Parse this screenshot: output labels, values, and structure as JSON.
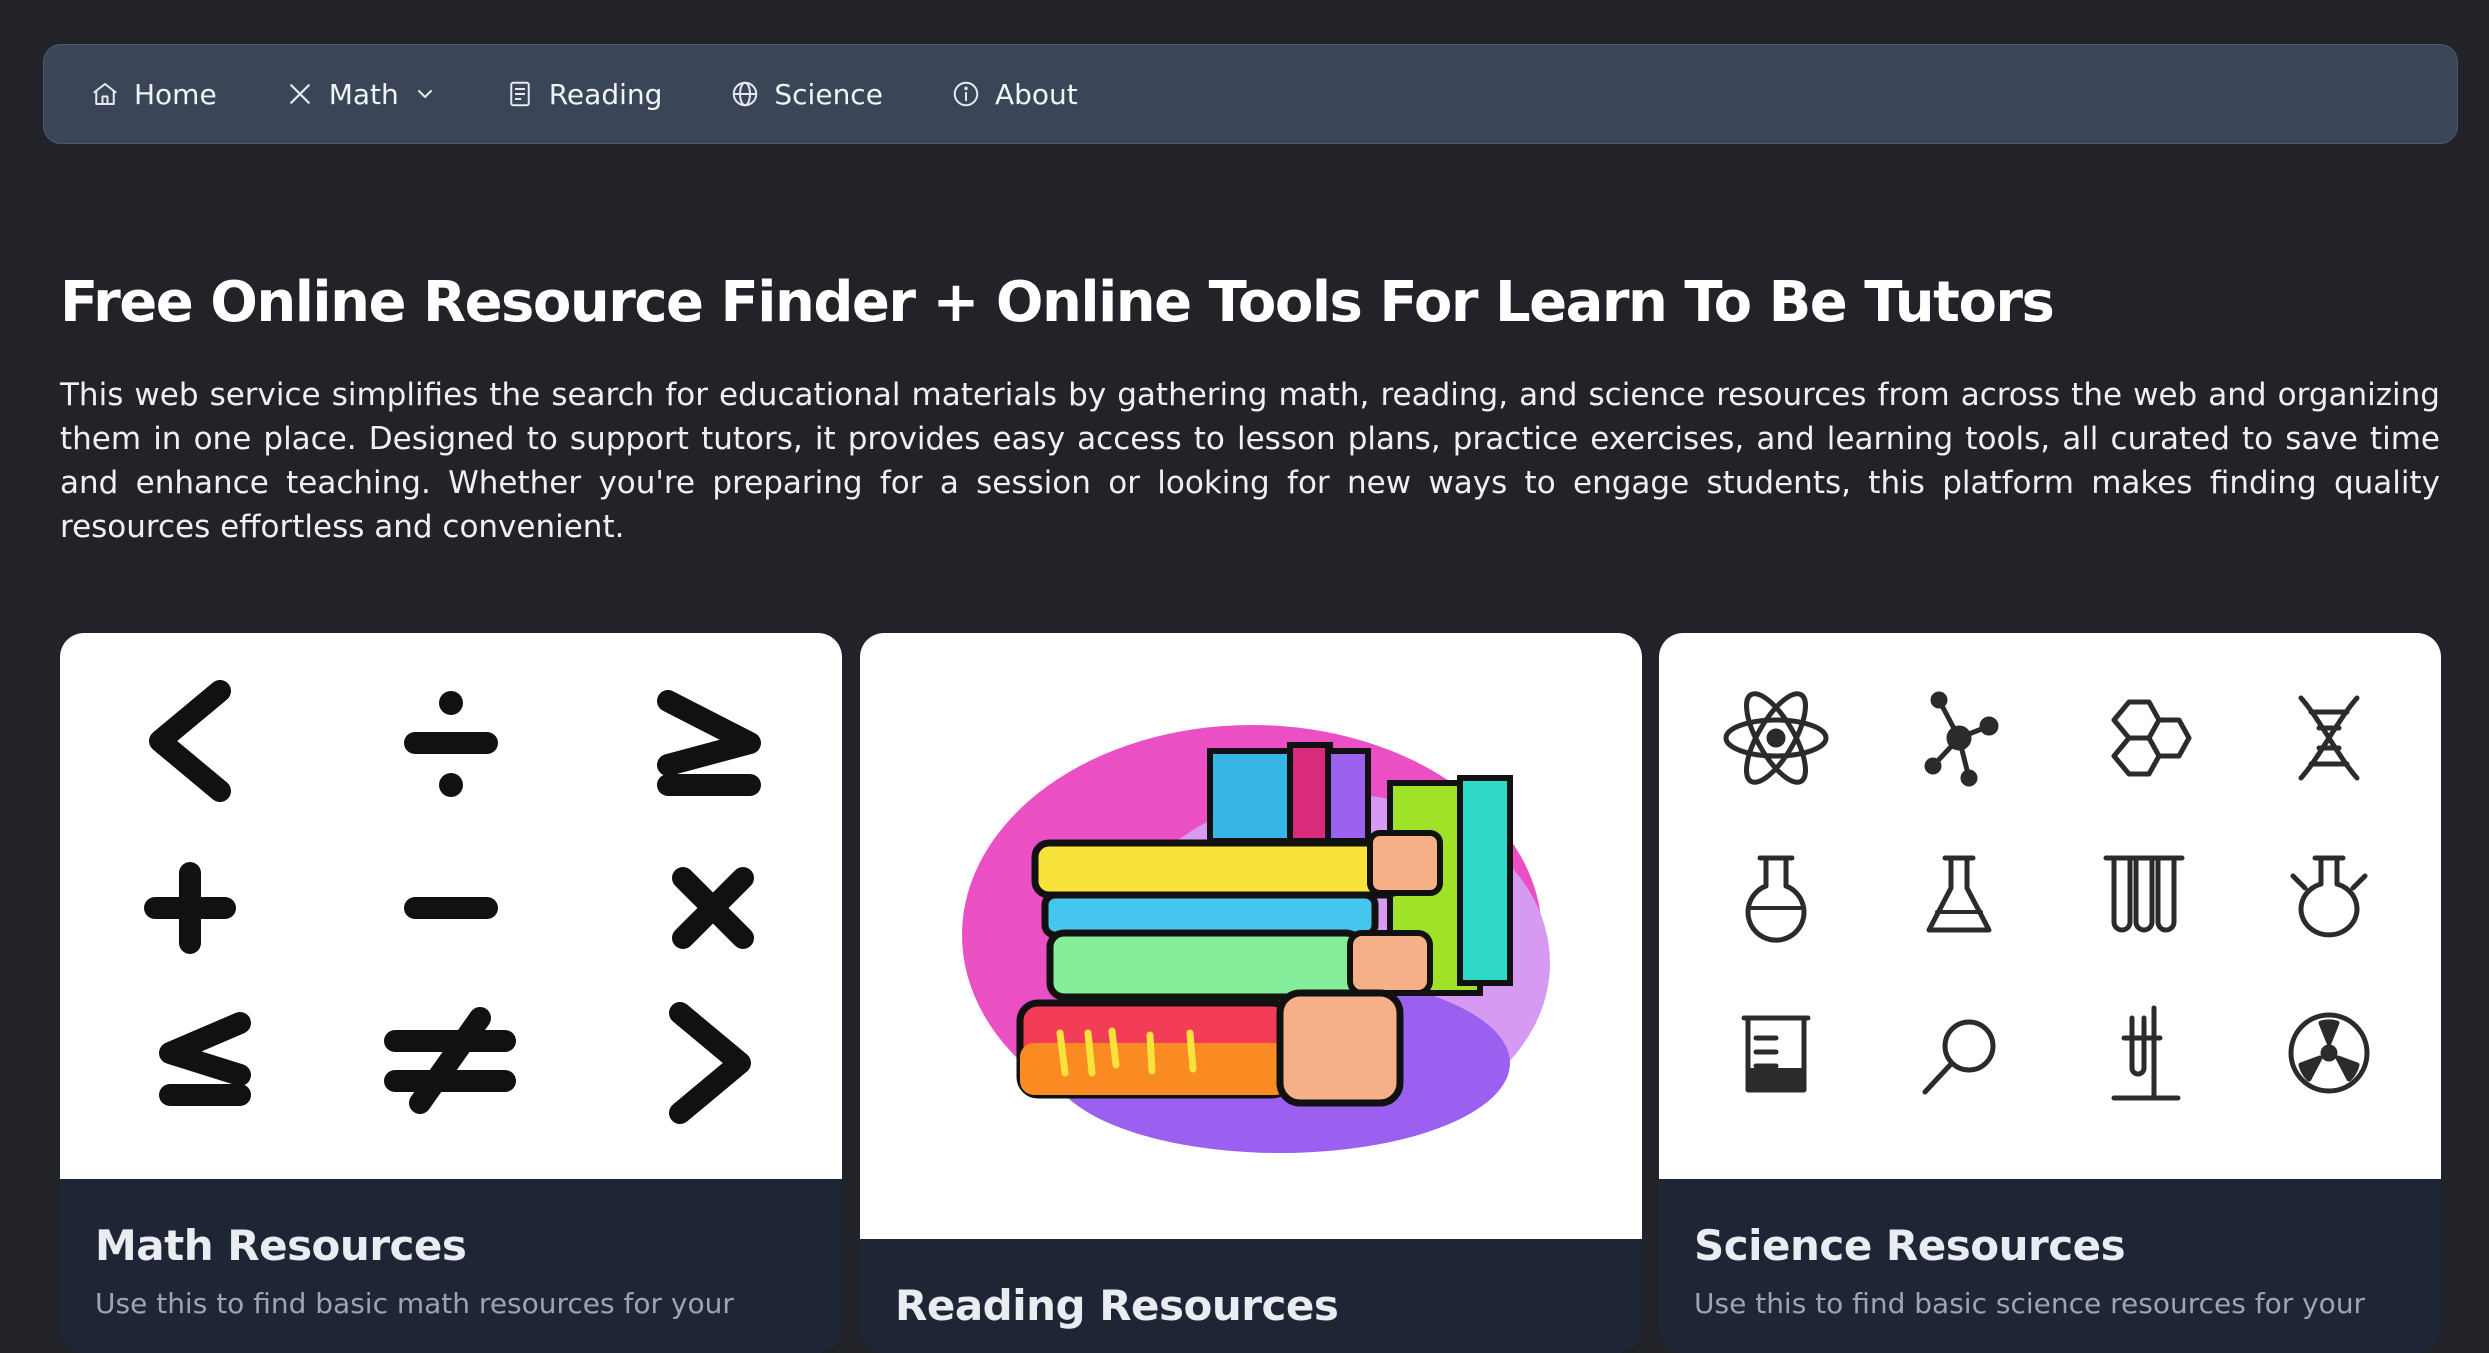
{
  "nav": {
    "items": [
      {
        "label": "Home",
        "icon": "home-icon"
      },
      {
        "label": "Math",
        "icon": "x-icon",
        "has_dropdown": true
      },
      {
        "label": "Reading",
        "icon": "book-icon"
      },
      {
        "label": "Science",
        "icon": "globe-icon"
      },
      {
        "label": "About",
        "icon": "info-icon"
      }
    ]
  },
  "page": {
    "title": "Free Online Resource Finder + Online Tools For Learn To Be Tutors",
    "intro": "This web service simplifies the search for educational materials by gathering math, reading, and science resources from across the web and organizing them in one place. Designed to support tutors, it provides easy access to lesson plans, practice exercises, and learning tools, all curated to save time and enhance teaching. Whether you're preparing for a session or looking for new ways to engage students, this platform makes finding quality resources effortless and convenient."
  },
  "cards": [
    {
      "title": "Math Resources",
      "description": "Use this to find basic math resources for your",
      "image": "math-symbols-image"
    },
    {
      "title": "Reading Resources",
      "image": "stack-of-books-image"
    },
    {
      "title": "Science Resources",
      "description": "Use this to find basic science resources for your",
      "image": "science-icons-image"
    }
  ],
  "colors": {
    "background": "#222329",
    "navbar": "#3a4558",
    "card_footer": "#1e2636",
    "card_desc": "#9aa4b3"
  }
}
